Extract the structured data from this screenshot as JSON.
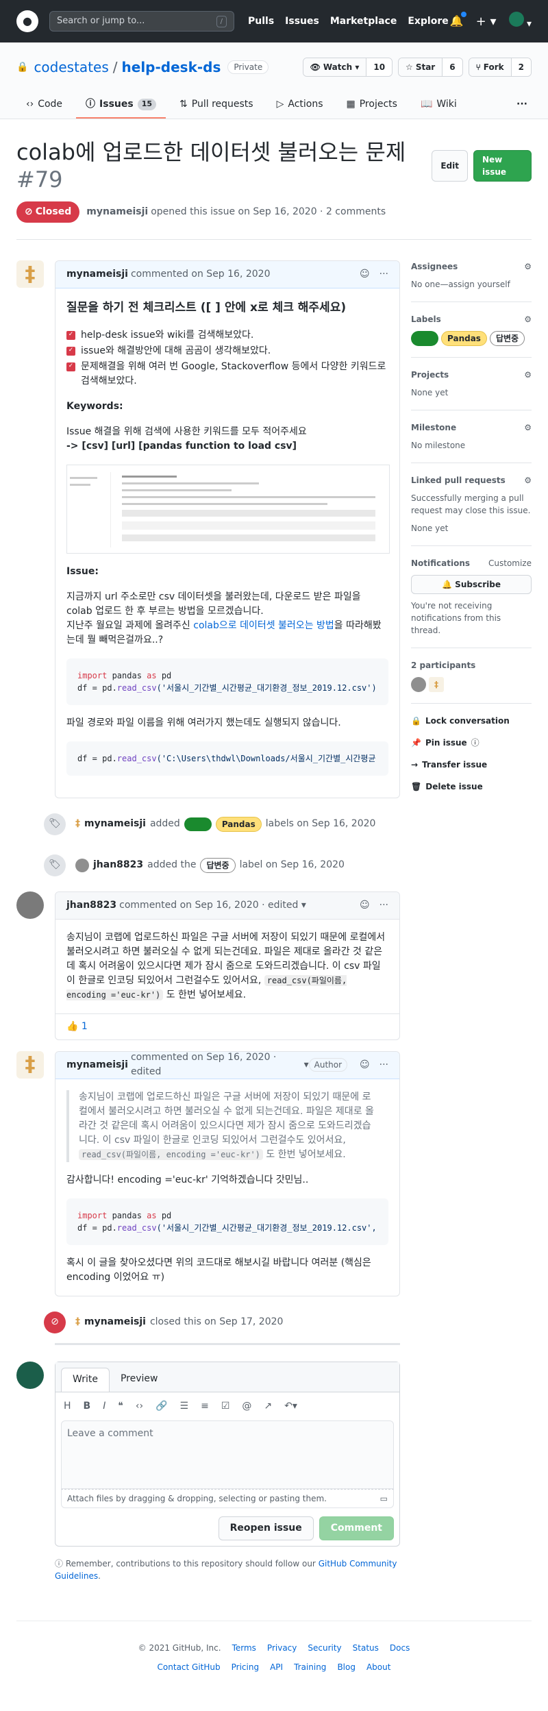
{
  "header": {
    "search_placeholder": "Search or jump to...",
    "search_key": "/",
    "nav": [
      "Pulls",
      "Issues",
      "Marketplace",
      "Explore"
    ]
  },
  "repo": {
    "owner": "codestates",
    "name": "help-desk-ds",
    "visibility": "Private",
    "watch_label": "Watch",
    "watch_count": "10",
    "star_label": "Star",
    "star_count": "6",
    "fork_label": "Fork",
    "fork_count": "2",
    "tabs": [
      {
        "label": "Code"
      },
      {
        "label": "Issues",
        "count": "15"
      },
      {
        "label": "Pull requests"
      },
      {
        "label": "Actions"
      },
      {
        "label": "Projects"
      },
      {
        "label": "Wiki"
      }
    ],
    "more": "···"
  },
  "issue": {
    "title": "colab에 업로드한 데이터셋 불러오는 문제",
    "number": "#79",
    "edit_label": "Edit",
    "new_issue_label": "New issue",
    "state": "Closed",
    "author": "mynameisji",
    "meta": "opened this issue on Sep 16, 2020 · 2 comments"
  },
  "first_comment": {
    "author": "mynameisji",
    "date": "commented on Sep 16, 2020",
    "heading": "질문을 하기 전 체크리스트 ([ ] 안에 x로 체크 해주세요)",
    "checklist": [
      "help-desk issue와 wiki를 검색해보았다.",
      "issue와 해결방안에 대해 곰곰이 생각해보았다.",
      "문제해결을 위해 여러 번 Google, Stackoverflow 등에서 다양한 키워드로 검색해보았다."
    ],
    "keywords_title": "Keywords:",
    "keywords_desc": "Issue 해결을 위해 검색에 사용한 키워드를 모두 적어주세요",
    "keywords_list": "-> [csv] [url] [pandas function to load csv]",
    "issue_title": "Issue:",
    "issue_text_1": "지금까지 url 주소로만 csv 데이터셋을 불러왔는데, 다운로드 받은 파일을 colab 업로드 한 후 부르는 방법을 모르겠습니다.",
    "issue_text_2_pre": "지난주 월요일 과제에 올려주신 ",
    "issue_text_2_link": "colab으로 데이터셋 불러오는 방법",
    "issue_text_2_post": "을 따라해봤는데 뭘 빼먹은걸까요..?",
    "code1_import": "import",
    "code1_pandas": " pandas ",
    "code1_as": "as",
    "code1_pd": " pd",
    "code1_line2_pre": "df = pd.",
    "code1_fn": "read_csv",
    "code1_arg": "('서울시_기간별_시간평균_대기환경_정보_2019.12.csv')",
    "after_code": "파일 경로와 파일 이름을 위해 여러가지 했는데도 실행되지 않습니다.",
    "code2_pre": "df = pd.",
    "code2_fn": "read_csv",
    "code2_arg": "('C:\\Users\\thdwl\\Downloads/서울시_기간별_시간평균"
  },
  "events": {
    "labels_added_actor": "mynameisji",
    "labels_added_text": "added",
    "labels_added_label1": "Pandas",
    "labels_added_suffix": "labels on Sep 16, 2020",
    "label_added_actor": "jhan8823",
    "label_added_text": "added the",
    "label_added_label": "답변중",
    "label_added_suffix": "label on Sep 16, 2020",
    "closed_actor": "mynameisji",
    "closed_text": "closed this on Sep 17, 2020"
  },
  "second_comment": {
    "author": "jhan8823",
    "date": "commented on Sep 16, 2020 · edited",
    "body_pre": "송지님이 코랩에 업로드하신 파일은 구글 서버에 저장이 되있기 때문에 로컬에서 불러오시려고 하면 불러오실 수 없게 되는건데요. 파일은 제대로 올라간 것 같은데 혹시 어려움이 있으시다면 제가 잠시 줌으로 도와드리겠습니다. 이 csv 파일이 한글로 인코딩 되있어서 그런걸수도 있어서요, ",
    "body_code": "read_csv(파일이름, encoding ='euc-kr')",
    "body_post": " 도 한번 넣어보세요.",
    "reaction": "👍 1"
  },
  "third_comment": {
    "author": "mynameisji",
    "date": "commented on Sep 16, 2020 · edited",
    "badge": "Author",
    "quote_pre": "송지님이 코랩에 업로드하신 파일은 구글 서버에 저장이 되있기 때문에 로컬에서 불러오시려고 하면 불러오실 수 없게 되는건데요. 파일은 제대로 올라간 것 같은데 혹시 어려움이 있으시다면 제가 잠시 줌으로 도와드리겠습니다. 이 csv 파일이 한글로 인코딩 되있어서 그런걸수도 있어서요, ",
    "quote_code": "read_csv(파일이름, encoding ='euc-kr')",
    "quote_post": " 도 한번 넣어보세요.",
    "thanks": "감사합니다! encoding ='euc-kr' 기억하겠습니다 갓민님..",
    "code_import": "import",
    "code_pandas": " pandas ",
    "code_as": "as",
    "code_pd": " pd",
    "code_line2_pre": "df = pd.",
    "code_fn": "read_csv",
    "code_arg": "('서울시_기간별_시간평균_대기환경_정보_2019.12.csv',",
    "closing": "혹시 이 글을 찾아오셨다면 위의 코드대로 해보시길 바랍니다 여러분 (핵심은 encoding 이었어요 ㅠ)"
  },
  "sidebar": {
    "assignees_title": "Assignees",
    "assignees_value": "No one—assign yourself",
    "labels_title": "Labels",
    "label_pandas": "Pandas",
    "label_answer": "답변중",
    "projects_title": "Projects",
    "projects_value": "None yet",
    "milestone_title": "Milestone",
    "milestone_value": "No milestone",
    "linked_title": "Linked pull requests",
    "linked_desc": "Successfully merging a pull request may close this issue.",
    "linked_value": "None yet",
    "notifications_title": "Notifications",
    "customize": "Customize",
    "subscribe": "Subscribe",
    "notif_desc": "You're not receiving notifications from this thread.",
    "participants": "2 participants",
    "lock": "Lock conversation",
    "pin": "Pin issue",
    "transfer": "Transfer issue",
    "delete": "Delete issue"
  },
  "new_comment": {
    "tab_write": "Write",
    "tab_preview": "Preview",
    "placeholder": "Leave a comment",
    "attach": "Attach files by dragging & dropping, selecting or pasting them.",
    "reopen": "Reopen issue",
    "comment": "Comment",
    "remember_pre": "Remember, contributions to this repository should follow our ",
    "remember_link": "GitHub Community Guidelines",
    "remember_post": "."
  },
  "footer": {
    "copyright": "© 2021 GitHub, Inc.",
    "row1": [
      "Terms",
      "Privacy",
      "Security",
      "Status",
      "Docs"
    ],
    "row2": [
      "Contact GitHub",
      "Pricing",
      "API",
      "Training",
      "Blog",
      "About"
    ]
  }
}
